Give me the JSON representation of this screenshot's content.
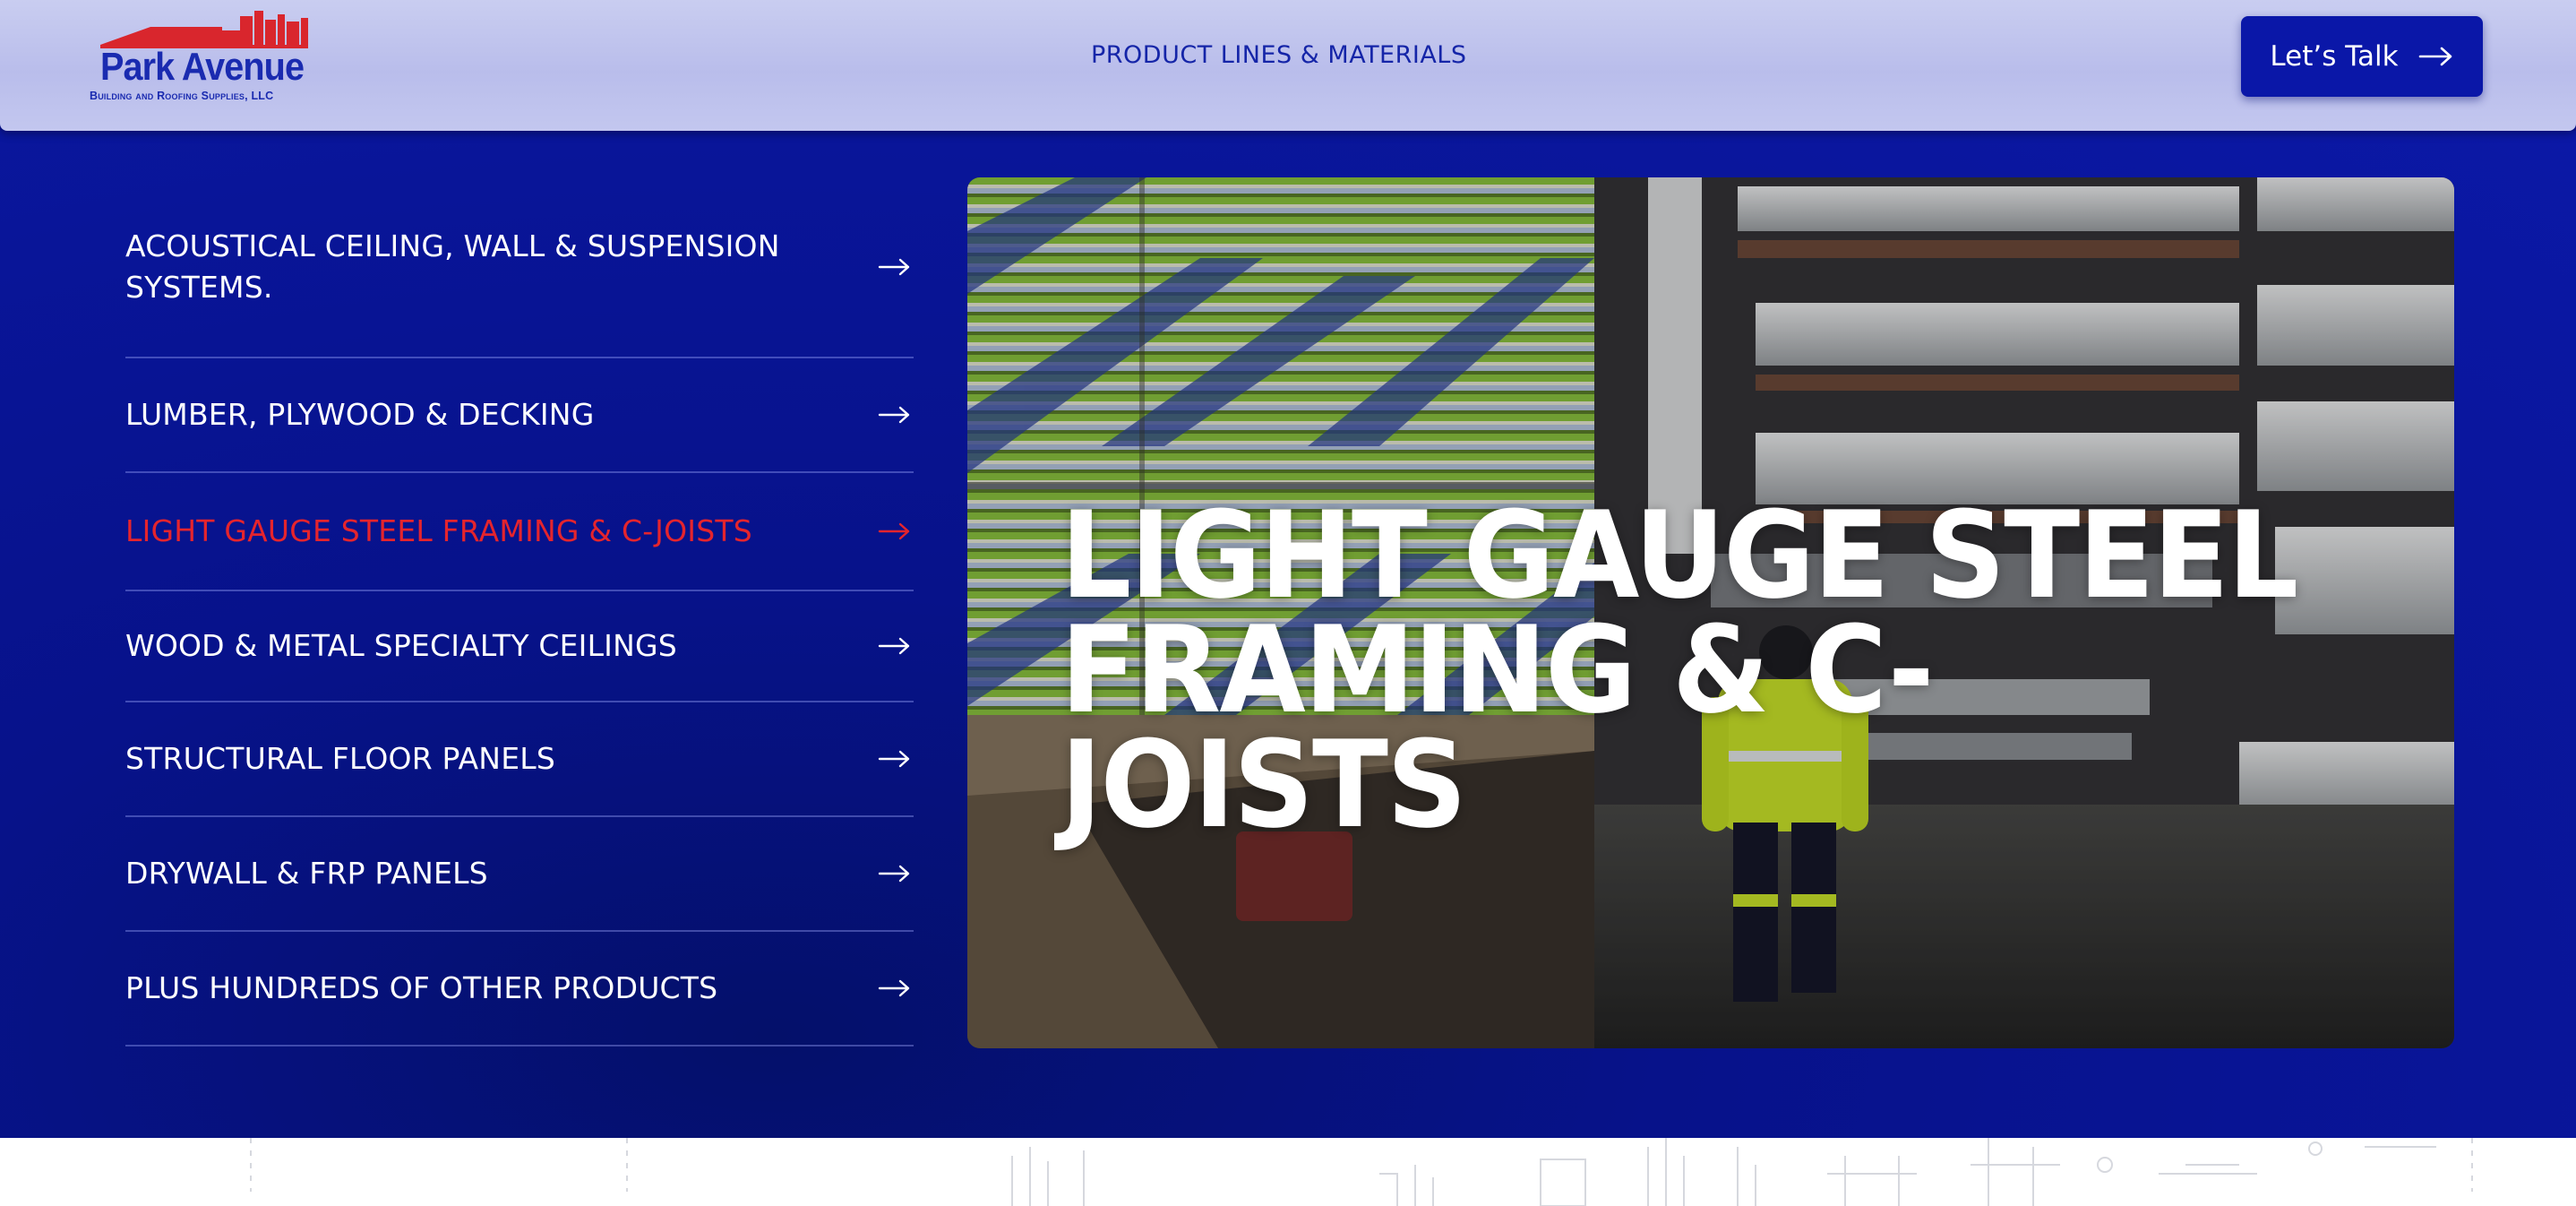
{
  "header": {
    "logo": {
      "name": "Park Avenue",
      "tagline": "Building and Roofing Supplies, LLC"
    },
    "nav_link": "PRODUCT LINES & MATERIALS",
    "cta_label": "Let’s Talk"
  },
  "menu": {
    "items": [
      {
        "label": "ACOUSTICAL CEILING, WALL & SUSPENSION SYSTEMS.",
        "active": false
      },
      {
        "label": "LUMBER, PLYWOOD & DECKING",
        "active": false
      },
      {
        "label": "LIGHT GAUGE STEEL FRAMING & C-JOISTS",
        "active": true
      },
      {
        "label": "WOOD & METAL SPECIALTY CEILINGS",
        "active": false
      },
      {
        "label": "STRUCTURAL FLOOR PANELS",
        "active": false
      },
      {
        "label": "DRYWALL & FRP PANELS",
        "active": false
      },
      {
        "label": "PLUS HUNDREDS OF OTHER PRODUCTS",
        "active": false
      }
    ]
  },
  "feature": {
    "title_line1": "LIGHT GAUGE STEEL",
    "title_line2": "FRAMING & C-JOISTS"
  },
  "colors": {
    "primary_blue": "#0a17a8",
    "active_red": "#e5242d",
    "header_lavender": "#c3c7ef"
  }
}
